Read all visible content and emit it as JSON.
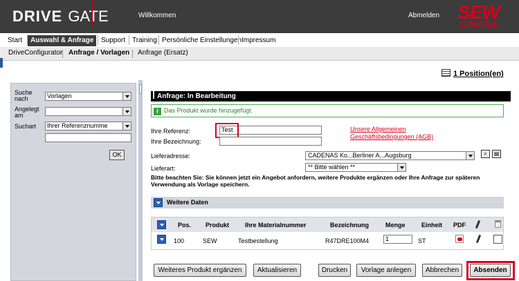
{
  "header": {
    "logo_drive": "DRIVE",
    "logo_gate": "GATE",
    "welcome": "Willkommen",
    "logout": "Abmelden",
    "brand_line1": "SEW",
    "brand_line2": "EURODRIVE"
  },
  "nav": {
    "items": [
      "Start",
      "Auswahl & Anfrage",
      "Support",
      "Training",
      "Persönliche Einstellungen",
      "Impressum"
    ],
    "active": "Auswahl & Anfrage"
  },
  "subnav": {
    "items": [
      "DriveConfigurator",
      "Anfrage / Vorlagen",
      "Anfrage (Ersatz)"
    ],
    "active": "Anfrage / Vorlagen"
  },
  "positions_link": "1 Position(en)",
  "search_panel": {
    "suche_nach_label": "Suche nach",
    "suche_nach_value": "Vorlagen",
    "angelegt_am_label": "Angelegt am",
    "angelegt_am_value": "",
    "suchart_label": "Suchart",
    "suchart_value": "Ihrer Referenznumme",
    "search_value": "",
    "ok_label": "OK"
  },
  "form": {
    "title": "Anfrage: In Bearbeitung",
    "info_message": "Das Produkt wurde hinzugefügt.",
    "referenz_label": "Ihre Referenz:",
    "referenz_value": "Test",
    "bezeichnung_label": "Ihre Bezeichnung:",
    "bezeichnung_value": "",
    "agb_link": "Unsere Allgemeinen Geschäftsbedingungen (AGB)",
    "lieferadresse_label": "Lieferadresse:",
    "lieferadresse_value": "CADENAS Ko...Berliner A...Augsburg",
    "lieferart_label": "Lieferart:",
    "lieferart_value": "** Bitte wählen **",
    "notice": "Bitte beachten Sie: Sie können jetzt ein Angebot anfordern, weitere Produkte ergänzen oder Ihre Anfrage zur späteren Verwendung als Vorlage speichern.",
    "weitere_daten": "Weitere Daten"
  },
  "table": {
    "headers": {
      "pos": "Pos.",
      "produkt": "Produkt",
      "materialnummer": "Ihre Materialnummer",
      "bezeichnung": "Bezeichnung",
      "menge": "Menge",
      "einheit": "Einheit",
      "pdf": "PDF"
    },
    "rows": [
      {
        "pos": "100",
        "produkt": "SEW",
        "materialnummer": "Testbestellung",
        "bezeichnung": "R47DRE100M4",
        "menge": "1",
        "einheit": "ST"
      }
    ]
  },
  "buttons": {
    "weiteres_produkt": "Weiteres Produkt ergänzen",
    "aktualisieren": "Aktualisieren",
    "drucken": "Drucken",
    "vorlage_anlegen": "Vorlage anlegen",
    "abbrechen": "Abbrechen",
    "absenden": "Absenden"
  },
  "colors": {
    "header_bg": "#3c3c3c",
    "brand_red": "#d8001c",
    "highlight": "#d8001c",
    "info_green": "#2e7d32",
    "panel_bg": "#d4d6dd",
    "accent_blue": "#2b5fb8"
  },
  "icons": {
    "info": "i",
    "print_icon": "printer",
    "address_book_icon": "address-book"
  }
}
